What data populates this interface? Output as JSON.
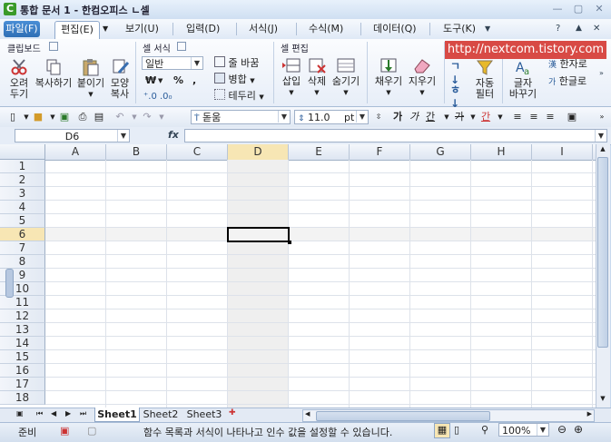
{
  "window": {
    "app_icon": "C",
    "title": "통합 문서 1 -  한컴오피스 ㄴ셀"
  },
  "menus": [
    "파일(F)",
    "편집(E)",
    "보기(U)",
    "입력(D)",
    "서식(J)",
    "수식(M)",
    "데이터(Q)",
    "도구(K)"
  ],
  "watermark": "http://nextcom.tistory.com",
  "ribbon": {
    "clipboard": {
      "title": "클립보드",
      "cut": "오려\n두기",
      "copy": "복사하기",
      "paste": "붙이기",
      "format_copy": "모양\n복사"
    },
    "cell_format": {
      "title": "셀 서식",
      "format_value": "일반",
      "wrap": "줄 바꿈",
      "merge": "병합",
      "border": "테두리",
      "currency": "₩",
      "percent": "%",
      "comma": ","
    },
    "cell_edit": {
      "title": "셀 편집",
      "insert": "삽입",
      "delete": "삭제",
      "hide": "숨기기",
      "fill": "채우기",
      "clear": "지우기",
      "auto_filter": "자동\n필터",
      "text_change": "글자\n바꾸기",
      "hanja": "한자로",
      "hangul": "한글로"
    }
  },
  "toolbar": {
    "font_name": "돋움",
    "font_size": "11.0",
    "font_unit": "pt",
    "bold": "가",
    "italic": "가",
    "underline": "간",
    "strike": "가",
    "font_color": "간"
  },
  "formula": {
    "cell_ref": "D6",
    "fx": "fx",
    "value": ""
  },
  "grid": {
    "columns": [
      "A",
      "B",
      "C",
      "D",
      "E",
      "F",
      "G",
      "H",
      "I"
    ],
    "rows": [
      "1",
      "2",
      "3",
      "4",
      "5",
      "6",
      "7",
      "8",
      "9",
      "10",
      "11",
      "12",
      "13",
      "14",
      "15",
      "16",
      "17",
      "18"
    ],
    "active_col": "D",
    "active_row": "6"
  },
  "sheets": [
    "Sheet1",
    "Sheet2",
    "Sheet3"
  ],
  "status": {
    "mode": "준비",
    "message": "함수 목록과 서식이 나타나고 인수 값을 설정할 수 있습니다.",
    "zoom": "100%"
  },
  "colors": {
    "accent": "#2f6fb5",
    "active_col_header": "#f7e6b4",
    "selection": "#000000"
  }
}
